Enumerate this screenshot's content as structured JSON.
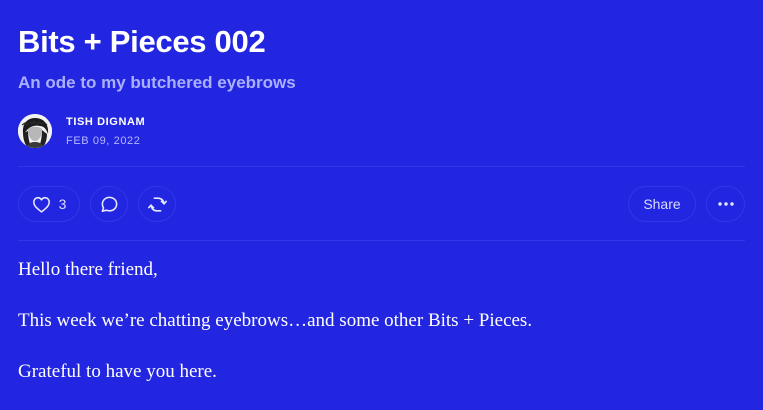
{
  "post": {
    "title": "Bits + Pieces 002",
    "subtitle": "An ode to my butchered eyebrows",
    "author": "TISH DIGNAM",
    "date": "FEB 09, 2022"
  },
  "actions": {
    "like_icon": "heart-icon",
    "like_count": "3",
    "comment_icon": "comment-bubble-icon",
    "restack_icon": "restack-icon",
    "share_label": "Share",
    "more_icon": "ellipsis-icon"
  },
  "body": {
    "paragraphs": [
      "Hello there friend,",
      "This week we’re chatting eyebrows…and some other Bits + Pieces.",
      "Grateful to have you here."
    ]
  },
  "colors": {
    "background": "#2326e0",
    "text": "#ffffff",
    "subtitle": "#aab0ff",
    "pill_border": "#3236ea"
  }
}
